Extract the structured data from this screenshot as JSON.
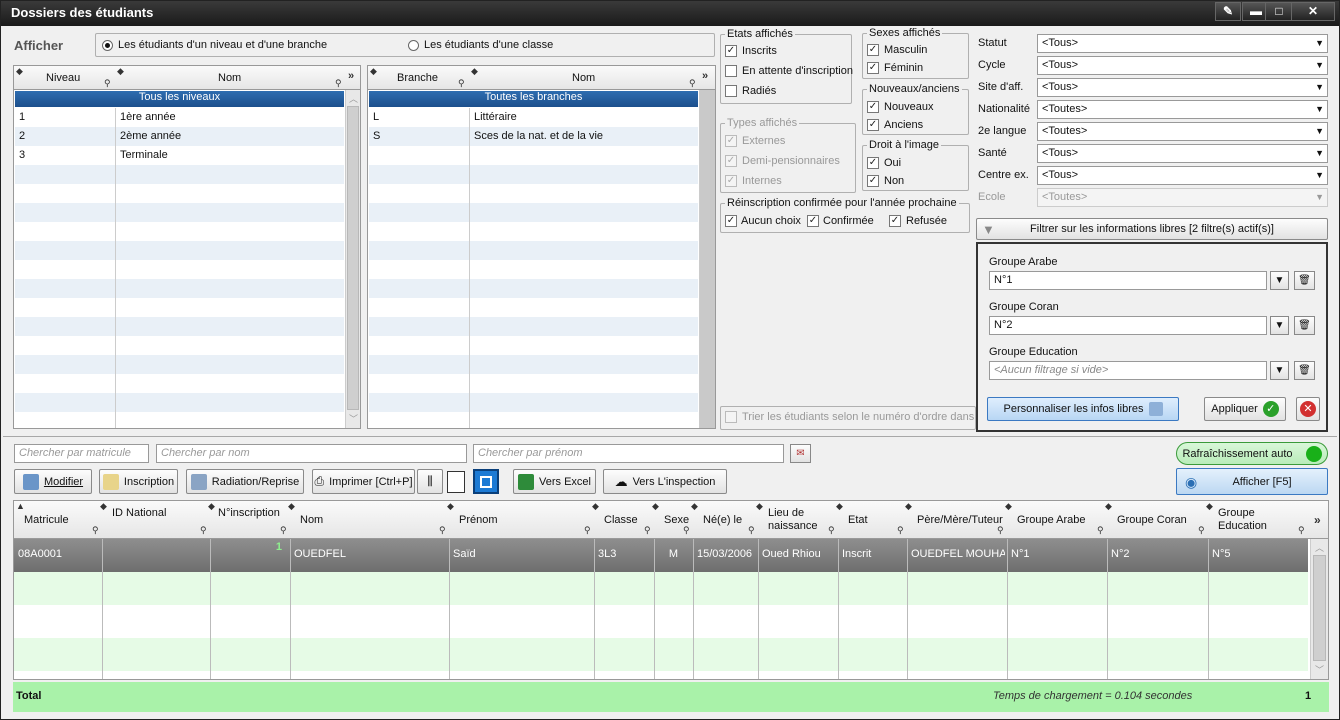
{
  "window": {
    "title": "Dossiers des étudiants"
  },
  "afficher": {
    "label": "Afficher",
    "option1": "Les étudiants d'un niveau et d'une branche",
    "option2": "Les étudiants d'une classe"
  },
  "niveaux": {
    "col1": "Niveau",
    "col2": "Nom",
    "all": "Tous les niveaux",
    "rows": [
      {
        "code": "1",
        "name": "1ère année"
      },
      {
        "code": "2",
        "name": "2ème année"
      },
      {
        "code": "3",
        "name": "Terminale"
      }
    ]
  },
  "branches": {
    "col1": "Branche",
    "col2": "Nom",
    "all": "Toutes les branches",
    "rows": [
      {
        "code": "L",
        "name": "Littéraire"
      },
      {
        "code": "S",
        "name": "Sces de la nat. et de la vie"
      }
    ]
  },
  "etats": {
    "title": "Etats affichés",
    "items": [
      "Inscrits",
      "En attente d'inscription",
      "Radiés"
    ]
  },
  "types": {
    "title": "Types affichés",
    "items": [
      "Externes",
      "Demi-pensionnaires",
      "Internes"
    ]
  },
  "sexes": {
    "title": "Sexes affichés",
    "items": [
      "Masculin",
      "Féminin"
    ]
  },
  "nouveaux": {
    "title": "Nouveaux/anciens",
    "items": [
      "Nouveaux",
      "Anciens"
    ]
  },
  "droit": {
    "title": "Droit à l'image",
    "items": [
      "Oui",
      "Non"
    ]
  },
  "reinscription": {
    "title": "Réinscription confirmée pour l'année prochaine",
    "items": [
      "Aucun choix",
      "Confirmée",
      "Refusée"
    ]
  },
  "trier": "Trier les étudiants selon le numéro d'ordre dans la",
  "filters": [
    {
      "label": "Statut",
      "value": "<Tous>"
    },
    {
      "label": "Cycle",
      "value": "<Tous>"
    },
    {
      "label": "Site d'aff.",
      "value": "<Tous>"
    },
    {
      "label": "Nationalité",
      "value": "<Toutes>"
    },
    {
      "label": "2e langue",
      "value": "<Toutes>"
    },
    {
      "label": "Santé",
      "value": "<Tous>"
    },
    {
      "label": "Centre ex.",
      "value": "<Tous>"
    },
    {
      "label": "Ecole",
      "value": "<Toutes>"
    }
  ],
  "libres": {
    "button": "Filtrer sur les informations libres [2 filtre(s) actif(s)]",
    "groups": [
      {
        "label": "Groupe Arabe",
        "value": "N°1"
      },
      {
        "label": "Groupe Coran",
        "value": "N°2"
      },
      {
        "label": "Groupe Education",
        "value": "<Aucun filtrage si vide>"
      }
    ],
    "personnaliser": "Personnaliser les infos libres",
    "appliquer": "Appliquer"
  },
  "search": {
    "matricule": "Chercher par matricule",
    "nom": "Chercher par nom",
    "prenom": "Chercher par prénom"
  },
  "rafraichissement": "Rafraîchissement auto",
  "toolbar": {
    "modifier": "Modifier",
    "inscription": "Inscription",
    "radiation": "Radiation/Reprise",
    "imprimer": "Imprimer [Ctrl+P]",
    "excel": "Vers Excel",
    "inspection": "Vers L'inspection",
    "afficher": "Afficher [F5]"
  },
  "grid": {
    "headers": [
      "Matricule",
      "ID National",
      "N°inscription",
      "Nom",
      "Prénom",
      "Classe",
      "Sexe",
      "Né(e) le",
      "Lieu de naissance",
      "Etat",
      "Père/Mère/Tuteur",
      "Groupe Arabe",
      "Groupe Coran",
      "Groupe Education"
    ],
    "row": [
      "08A0001",
      "",
      "1",
      "OUEDFEL",
      "Saïd",
      "3L3",
      "M",
      "15/03/2006",
      "Oued Rhiou",
      "Inscrit",
      "OUEDFEL MOUHA",
      "N°1",
      "N°2",
      "N°5"
    ]
  },
  "footer": {
    "total": "Total",
    "temps": "Temps de chargement = 0.104 secondes",
    "count": "1"
  }
}
